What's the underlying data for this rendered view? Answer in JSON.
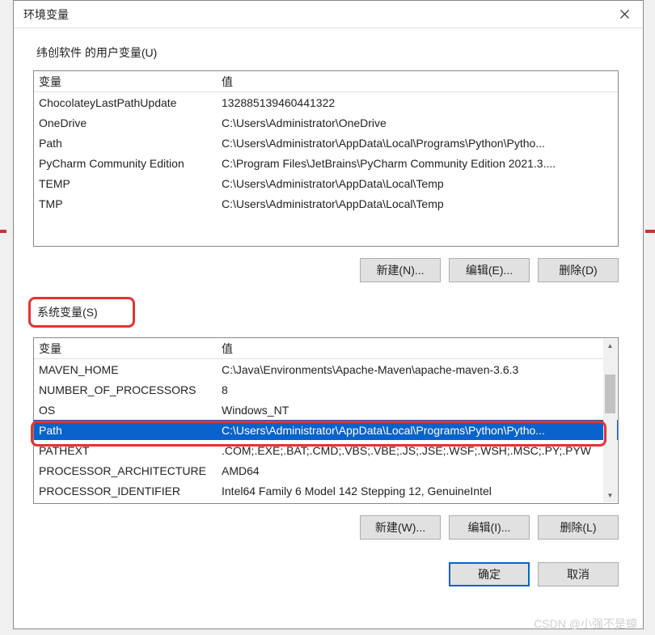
{
  "title": "环境变量",
  "user_section": {
    "label": "纬创软件 的用户变量(U)",
    "columns": {
      "variable": "变量",
      "value": "值"
    },
    "rows": [
      {
        "var": "ChocolateyLastPathUpdate",
        "val": "132885139460441322"
      },
      {
        "var": "OneDrive",
        "val": "C:\\Users\\Administrator\\OneDrive"
      },
      {
        "var": "Path",
        "val": "C:\\Users\\Administrator\\AppData\\Local\\Programs\\Python\\Pytho..."
      },
      {
        "var": "PyCharm Community Edition",
        "val": "C:\\Program Files\\JetBrains\\PyCharm Community Edition 2021.3...."
      },
      {
        "var": "TEMP",
        "val": "C:\\Users\\Administrator\\AppData\\Local\\Temp"
      },
      {
        "var": "TMP",
        "val": "C:\\Users\\Administrator\\AppData\\Local\\Temp"
      }
    ],
    "buttons": {
      "new": "新建(N)...",
      "edit": "编辑(E)...",
      "delete": "删除(D)"
    }
  },
  "system_section": {
    "label": "系统变量(S)",
    "columns": {
      "variable": "变量",
      "value": "值"
    },
    "rows": [
      {
        "var": "MAVEN_HOME",
        "val": "C:\\Java\\Environments\\Apache-Maven\\apache-maven-3.6.3"
      },
      {
        "var": "NUMBER_OF_PROCESSORS",
        "val": "8"
      },
      {
        "var": "OS",
        "val": "Windows_NT"
      },
      {
        "var": "Path",
        "val": "C:\\Users\\Administrator\\AppData\\Local\\Programs\\Python\\Pytho...",
        "selected": true
      },
      {
        "var": "PATHEXT",
        "val": ".COM;.EXE;.BAT;.CMD;.VBS;.VBE;.JS;.JSE;.WSF;.WSH;.MSC;.PY;.PYW"
      },
      {
        "var": "PROCESSOR_ARCHITECTURE",
        "val": "AMD64"
      },
      {
        "var": "PROCESSOR_IDENTIFIER",
        "val": "Intel64 Family 6 Model 142 Stepping 12, GenuineIntel"
      }
    ],
    "buttons": {
      "new": "新建(W)...",
      "edit": "编辑(I)...",
      "delete": "删除(L)"
    }
  },
  "dialog_buttons": {
    "ok": "确定",
    "cancel": "取消"
  },
  "watermark": "CSDN @小强不是蟑"
}
